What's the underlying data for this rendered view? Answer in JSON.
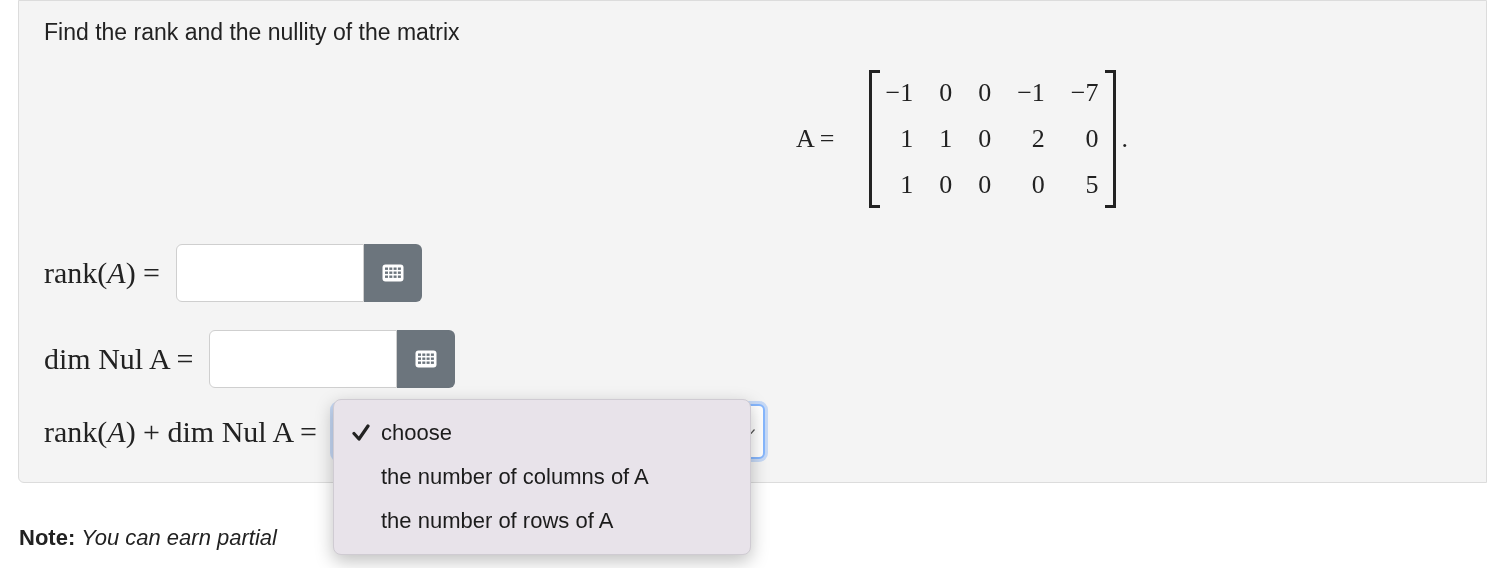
{
  "question": {
    "prompt": "Find the rank and the nullity of the matrix",
    "matrix_label": "A =",
    "matrix": [
      [
        "−1",
        "0",
        "0",
        "−1",
        "−7"
      ],
      [
        "1",
        "1",
        "0",
        "2",
        "0"
      ],
      [
        "1",
        "0",
        "0",
        "0",
        "5"
      ]
    ],
    "matrix_end": "."
  },
  "answers": [
    {
      "kind": "input",
      "label": "rank(*A*) ="
    },
    {
      "kind": "input",
      "label": "dim Nul A ="
    },
    {
      "kind": "select",
      "label": "rank(*A*) + dim Nul A =",
      "expanded": true,
      "options": [
        {
          "label": "choose",
          "selected": true
        },
        {
          "label": "the number of columns of A",
          "selected": false
        },
        {
          "label": "the number of rows of A",
          "selected": false
        }
      ]
    }
  ],
  "note": {
    "label": "Note:",
    "text": "You can earn partial"
  }
}
